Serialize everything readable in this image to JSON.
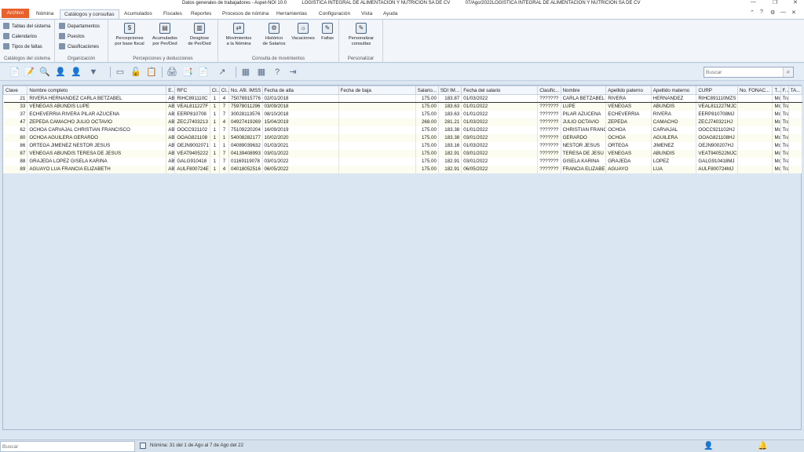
{
  "window": {
    "title_left": "Datos generales de trabajadores - Aspel-NOI 10.0",
    "title_company": "LOGISTICA INTEGRAL DE ALIMENTACION Y NUTRICION SA DE CV",
    "title_right": "07/Ago/2022LOGISTICA INTEGRAL DE ALIMENTACION Y NUTRICION SA DE CV",
    "controls": {
      "minimize": "—",
      "restore": "❐",
      "close": "✕"
    },
    "ribbon_controls": {
      "collapse": "⌃",
      "help": "?",
      "settings": "⚙",
      "minimize": "—",
      "close": "✕"
    }
  },
  "menu": {
    "tabs": [
      "Archivo",
      "Nómina",
      "Catálogos y consultas",
      "Acumulados",
      "Fiscales",
      "Reportes",
      "Procesos de nómina",
      "Herramientas",
      "Configuración",
      "Vista",
      "Ayuda"
    ],
    "active": "Catálogos y consultas"
  },
  "ribbon": {
    "catalogos": {
      "label": "Catálogos del sistema",
      "items": [
        "Tablas del sistema",
        "Calendarios",
        "Tipos de faltas"
      ]
    },
    "organizacion": {
      "label": "Organización",
      "items": [
        "Departamentos",
        "Puestos",
        "Clasificaciones"
      ]
    },
    "percepciones": {
      "label": "Percepciones y deducciones",
      "items": [
        {
          "l1": "Percepciones",
          "l2": "por base fiscal",
          "icon": "$"
        },
        {
          "l1": "Acumulados",
          "l2": "por Per/Ded",
          "icon": "▤"
        },
        {
          "l1": "Desglose",
          "l2": "de Per/Ded",
          "icon": "▥"
        }
      ]
    },
    "movimientos": {
      "label": "Consulta de movimientos",
      "items": [
        {
          "l1": "Movimientos",
          "l2": "a la Nómina",
          "icon": "⇄"
        },
        {
          "l1": "Histórico",
          "l2": "de Salarios",
          "icon": "⚙"
        },
        {
          "l1": "Vacaciones",
          "l2": "",
          "icon": "☼"
        },
        {
          "l1": "Faltas",
          "l2": "",
          "icon": "✎"
        }
      ]
    },
    "personalizar": {
      "label": "Personalizar",
      "items": [
        {
          "l1": "Personalizar",
          "l2": "consultas",
          "icon": "✎"
        }
      ]
    }
  },
  "toolbar": {
    "search_placeholder": "Buscar",
    "search_icon": "⌕",
    "icons": [
      "📄",
      "📝",
      "🔍",
      "👤",
      "👤",
      "▼",
      "▭",
      "🔓",
      "📋",
      "🖨",
      "📑",
      "📄",
      "↗",
      "▦",
      "▦",
      "?",
      "⇥"
    ]
  },
  "grid": {
    "columns": [
      "Clave",
      "Nombre completo",
      "E...",
      "RFC",
      "Cl...",
      "Cl...",
      "No. Afil. IMSS",
      "Fecha de alta",
      "Fecha de baja",
      "Salario...",
      "SDI IM...",
      "Fecha del salario",
      "Clasific...",
      "Nombre",
      "Apellido paterno",
      "Apellido materno",
      "CURP",
      "No. FONAC...",
      "T...",
      "F...",
      "TA..."
    ],
    "rows": [
      [
        "21",
        "RIVERA HERNANDEZ CARLA BETZABEL",
        "AB",
        "RIHC891110C",
        "1",
        "4",
        "75078915776",
        "02/01/2018",
        "",
        "175.00",
        "183.87",
        "01/03/2022",
        "???????",
        "CARLA BETZABEL",
        "RIVERA",
        "HERNANDEZ",
        "RIHC891110MZS",
        "",
        "Mo",
        "Tra",
        ""
      ],
      [
        "33",
        "VENEGAS ABUNDIS LUPE",
        "AB",
        "VEAL811227F",
        "1",
        "7",
        "75978011296",
        "03/09/2018",
        "",
        "175.00",
        "183.63",
        "01/01/2022",
        "???????",
        "LUPE",
        "VENEGAS",
        "ABUNDIS",
        "VEAL811227MJC",
        "",
        "Mo",
        "Tra",
        ""
      ],
      [
        "37",
        "ECHEVERRIA RIVERA PILAR AZUCENA",
        "AB",
        "EERP810708",
        "1",
        "7",
        "30028113576",
        "08/10/2018",
        "",
        "175.00",
        "183.63",
        "01/01/2022",
        "???????",
        "PILAR AZUCENA",
        "ECHEVERRIA",
        "RIVERA",
        "EERP810708MJ",
        "",
        "Mo",
        "Tra",
        ""
      ],
      [
        "47",
        "ZEPEDA CAMACHO JULIO OCTAVIO",
        "AB",
        "ZECJ7403213",
        "1",
        "4",
        "04927419269",
        "15/04/2019",
        "",
        "268.00",
        "281.21",
        "01/03/2022",
        "???????",
        "JULIO OCTAVIO",
        "ZEPEDA",
        "CAMACHO",
        "ZECJ740321HJ",
        "",
        "Mo",
        "Tra",
        ""
      ],
      [
        "62",
        "OCHOA CARVAJAL CHRISTIAN FRANCISCO",
        "AB",
        "OOCC921102",
        "1",
        "7",
        "75109220204",
        "16/09/2019",
        "",
        "175.00",
        "183.38",
        "01/01/2022",
        "???????",
        "CHRISTIAN FRANC",
        "OCHOA",
        "CARVAJAL",
        "OOCC921102HJ",
        "",
        "Mo",
        "Tra",
        ""
      ],
      [
        "80",
        "OCHOA AGUILERA GERARDO",
        "AB",
        "OOAG821108",
        "1",
        "1",
        "54008282177",
        "10/02/2020",
        "",
        "175.00",
        "183.38",
        "03/01/2022",
        "???????",
        "GERARDO",
        "OCHOA",
        "AGUILERA",
        "OOAG821108HJ",
        "",
        "Mo",
        "Tra",
        ""
      ],
      [
        "86",
        "ORTEGA JIMENEZ NESTOR JESUS",
        "AB",
        "OEJN9002071",
        "1",
        "1",
        "04089039632",
        "01/03/2021",
        "",
        "175.00",
        "183.16",
        "01/03/2022",
        "???????",
        "NESTOR JESUS",
        "ORTEGA",
        "JIMENEZ",
        "OEJN900207HJ",
        "",
        "Mo",
        "Tra",
        ""
      ],
      [
        "87",
        "VENEGAS ABUNDIS TERESA DE JESUS",
        "AB",
        "VEAT9405222",
        "1",
        "7",
        "04139408993",
        "03/01/2022",
        "",
        "175.00",
        "182.91",
        "03/01/2022",
        "???????",
        "TERESA DE JESU",
        "VENEGAS",
        "ABUNDIS",
        "VEAT940522MJC",
        "",
        "Mo",
        "Tra",
        ""
      ],
      [
        "88",
        "GRAJEDA LOPEZ GISELA KARINA",
        "AB",
        "GALG910418",
        "1",
        "7",
        "01169119078",
        "03/01/2022",
        "",
        "175.00",
        "182.91",
        "03/01/2022",
        "???????",
        "GISELA KARINA",
        "GRAJEDA",
        "LOPEZ",
        "GALG910418MJ",
        "",
        "Mo",
        "Tra",
        ""
      ],
      [
        "89",
        "AGUAYO LUA FRANCIA ELIZABETH",
        "AB",
        "AULF800724E",
        "1",
        "4",
        "04018052516",
        "06/05/2022",
        "",
        "175.00",
        "182.91",
        "06/05/2022",
        "???????",
        "FRANCIA ELIZABE",
        "AGUAYO",
        "LUA",
        "AULF800724MJ",
        "",
        "Mo",
        "Tra",
        ""
      ]
    ]
  },
  "statusbar": {
    "search_placeholder": "Buscar",
    "text": "Nómina: 31 del 1 de Ago al 7 de Ago del 22",
    "user_icon": "👤",
    "bell_icon": "🔔"
  }
}
